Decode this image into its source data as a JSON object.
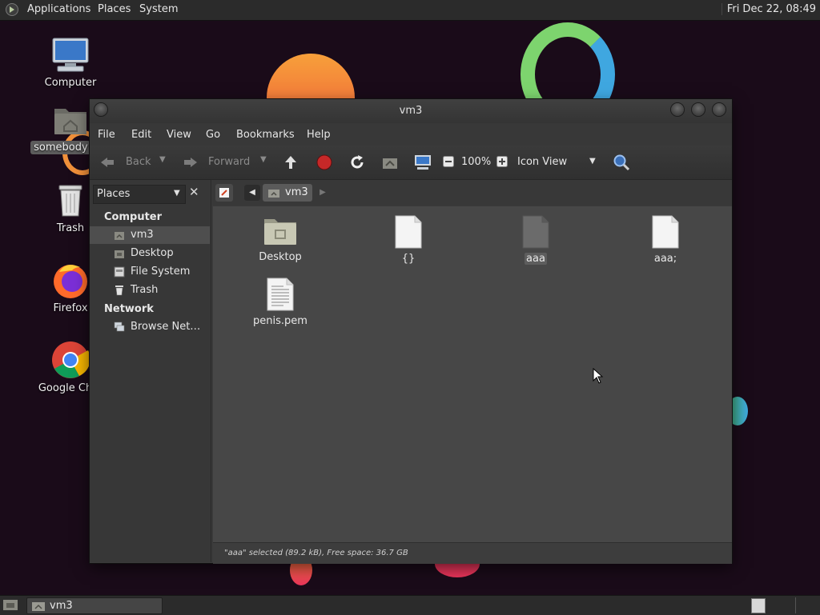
{
  "top_panel": {
    "menus": [
      "Applications",
      "Places",
      "System"
    ],
    "clock": "Fri Dec 22, 08:49"
  },
  "desktop": {
    "icons": [
      {
        "label": "Computer",
        "icon": "monitor-icon"
      },
      {
        "label": "somebody's H",
        "icon": "home-folder-icon",
        "selected": true
      },
      {
        "label": "Trash",
        "icon": "trash-icon"
      },
      {
        "label": "Firefox",
        "icon": "firefox-icon"
      },
      {
        "label": "Google Chro",
        "icon": "chrome-icon"
      }
    ]
  },
  "window": {
    "title": "vm3",
    "menu": [
      "File",
      "Edit",
      "View",
      "Go",
      "Bookmarks",
      "Help"
    ],
    "toolbar": {
      "back": "Back",
      "forward": "Forward",
      "zoom": "100%",
      "view_mode": "Icon View"
    },
    "sidebar": {
      "selector": "Places",
      "sections": [
        {
          "heading": "Computer",
          "items": [
            {
              "label": "vm3",
              "icon": "home-icon",
              "selected": true
            },
            {
              "label": "Desktop",
              "icon": "desktop-icon"
            },
            {
              "label": "File System",
              "icon": "drive-icon"
            },
            {
              "label": "Trash",
              "icon": "trash-icon"
            }
          ]
        },
        {
          "heading": "Network",
          "items": [
            {
              "label": "Browse Net…",
              "icon": "network-icon"
            }
          ]
        }
      ]
    },
    "path": [
      "vm3"
    ],
    "files": [
      {
        "name": "Desktop",
        "icon": "folder-icon"
      },
      {
        "name": "{}",
        "icon": "blank-file-icon"
      },
      {
        "name": "aaa",
        "icon": "blank-file-icon",
        "selected": true
      },
      {
        "name": "aaa;",
        "icon": "blank-file-icon"
      },
      {
        "name": "penis.pem",
        "icon": "text-file-icon"
      }
    ],
    "status": "\"aaa\" selected (89.2 kB), Free space: 36.7 GB"
  },
  "taskbar": {
    "items": [
      {
        "label": "vm3",
        "icon": "home-folder-icon"
      }
    ]
  },
  "colors": {
    "desktop_bg": "#1a0b19",
    "panel_bg": "#2b2b2b",
    "window_bg": "#3a3a3a",
    "content_bg": "#474747",
    "stop_red": "#c62828"
  }
}
